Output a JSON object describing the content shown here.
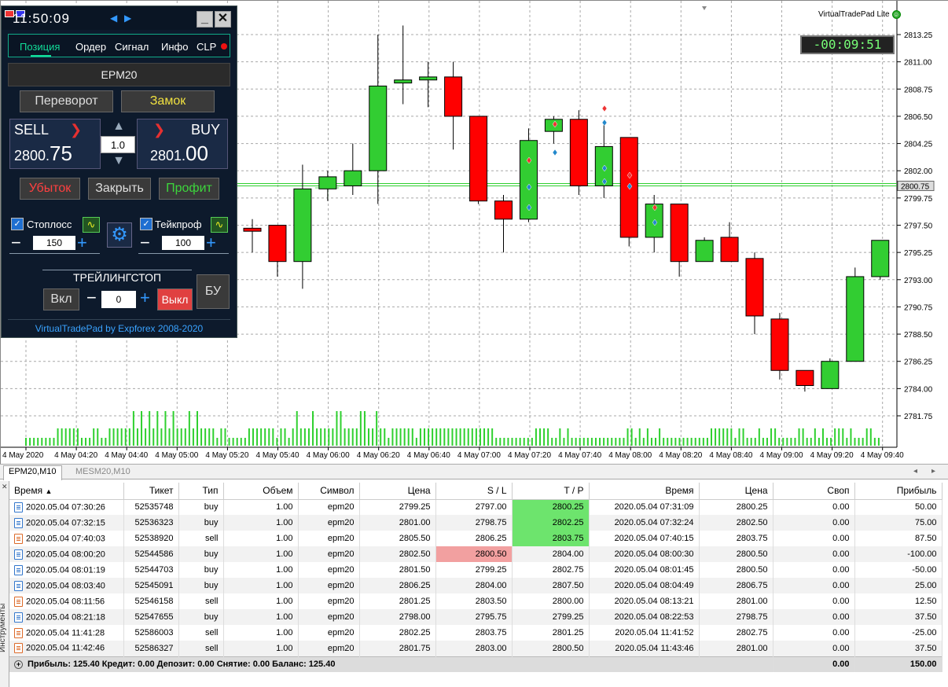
{
  "ea": {
    "title": "VirtualTradePad",
    "edition": "Lite"
  },
  "timer": "-00:09:51",
  "pad": {
    "clock": "11:50:09",
    "tabs": [
      "Позиция",
      "Ордер",
      "Сигнал",
      "Инфо",
      "CLP"
    ],
    "symbol": "EPM20",
    "reverse_label": "Переворот",
    "lock_label": "Замок",
    "sell_label": "SELL",
    "buy_label": "BUY",
    "sell_int": "2800.",
    "sell_frac": "75",
    "buy_int": "2801.",
    "buy_frac": "00",
    "lot": "1.0",
    "loss_label": "Убыток",
    "close_label": "Закрыть",
    "profit_label": "Профит",
    "sl_label": "Стоплосс",
    "sl_value": "150",
    "tp_label": "Тейкпроф",
    "tp_value": "100",
    "trailing_label": "ТРЕЙЛИНГСТОП",
    "on_label": "Вкл",
    "off_label": "Выкл",
    "trail_value": "0",
    "be_label": "БУ",
    "footer": "VirtualTradePad by Expforex 2008-2020",
    "colors": {
      "sell_arrow": "#e63030",
      "profit_text": "#3cd63c",
      "loss_text": "#ff4040",
      "lock_text": "#f0e040"
    }
  },
  "chart_data": {
    "type": "candlestick",
    "x_ticks": [
      "4 May 2020",
      "4 May 04:20",
      "4 May 04:40",
      "4 May 05:00",
      "4 May 05:20",
      "4 May 05:40",
      "4 May 06:00",
      "4 May 06:20",
      "4 May 06:40",
      "4 May 07:00",
      "4 May 07:20",
      "4 May 07:40",
      "4 May 08:00",
      "4 May 08:20",
      "4 May 08:40",
      "4 May 09:00",
      "4 May 09:20",
      "4 May 09:40"
    ],
    "y_ticks": [
      "2813.25",
      "2811.00",
      "2808.75",
      "2806.50",
      "2804.25",
      "2802.00",
      "2799.75",
      "2797.50",
      "2795.25",
      "2793.00",
      "2790.75",
      "2788.50",
      "2786.25",
      "2784.00",
      "2781.75"
    ],
    "ylim": [
      2780.0,
      2815.25
    ],
    "current_price": "2800.75",
    "current_price_value": 2800.75,
    "candles": [
      {
        "o": 2797.25,
        "h": 2798.0,
        "l": 2795.25,
        "c": 2797.0
      },
      {
        "o": 2797.5,
        "h": 2797.5,
        "l": 2793.25,
        "c": 2794.5
      },
      {
        "o": 2794.5,
        "h": 2802.5,
        "l": 2792.25,
        "c": 2800.5
      },
      {
        "o": 2800.5,
        "h": 2802.0,
        "l": 2799.5,
        "c": 2801.5
      },
      {
        "o": 2800.75,
        "h": 2804.25,
        "l": 2800.0,
        "c": 2802.0
      },
      {
        "o": 2802.0,
        "h": 2813.25,
        "l": 2799.25,
        "c": 2809.0
      },
      {
        "o": 2809.25,
        "h": 2814.0,
        "l": 2807.5,
        "c": 2809.5
      },
      {
        "o": 2809.5,
        "h": 2811.0,
        "l": 2807.25,
        "c": 2809.75
      },
      {
        "o": 2809.75,
        "h": 2811.0,
        "l": 2803.75,
        "c": 2806.5
      },
      {
        "o": 2806.5,
        "h": 2806.5,
        "l": 2799.25,
        "c": 2799.5
      },
      {
        "o": 2799.5,
        "h": 2800.0,
        "l": 2795.25,
        "c": 2798.0
      },
      {
        "o": 2798.0,
        "h": 2805.5,
        "l": 2797.75,
        "c": 2804.5
      },
      {
        "o": 2805.25,
        "h": 2806.5,
        "l": 2804.25,
        "c": 2806.25
      },
      {
        "o": 2806.25,
        "h": 2807.0,
        "l": 2800.0,
        "c": 2800.75
      },
      {
        "o": 2800.75,
        "h": 2806.0,
        "l": 2799.75,
        "c": 2804.0
      },
      {
        "o": 2804.75,
        "h": 2804.75,
        "l": 2795.75,
        "c": 2796.5
      },
      {
        "o": 2796.5,
        "h": 2800.0,
        "l": 2795.25,
        "c": 2799.25
      },
      {
        "o": 2799.25,
        "h": 2799.25,
        "l": 2793.25,
        "c": 2794.5
      },
      {
        "o": 2794.5,
        "h": 2796.5,
        "l": 2794.5,
        "c": 2796.25
      },
      {
        "o": 2796.5,
        "h": 2797.75,
        "l": 2794.5,
        "c": 2794.5
      },
      {
        "o": 2794.75,
        "h": 2795.25,
        "l": 2788.5,
        "c": 2790.0
      },
      {
        "o": 2789.75,
        "h": 2790.25,
        "l": 2784.75,
        "c": 2785.5
      },
      {
        "o": 2785.5,
        "h": 2785.5,
        "l": 2783.75,
        "c": 2784.25
      },
      {
        "o": 2784.0,
        "h": 2786.5,
        "l": 2784.0,
        "c": 2786.25
      },
      {
        "o": 2786.25,
        "h": 2794.0,
        "l": 2786.25,
        "c": 2793.25
      },
      {
        "o": 2793.25,
        "h": 2796.25,
        "l": 2793.0,
        "c": 2796.25
      }
    ],
    "volumes": [
      1,
      1,
      1,
      1,
      1,
      1,
      1,
      1,
      2,
      2,
      2,
      2,
      2,
      2,
      1,
      1,
      1,
      2,
      2,
      1,
      1,
      2,
      2,
      2,
      2,
      2,
      2,
      3,
      2,
      3,
      2,
      3,
      2,
      3,
      2,
      3,
      2,
      3,
      2,
      2,
      2,
      3,
      2,
      3,
      2,
      2,
      2,
      2,
      1,
      2,
      2,
      1,
      1,
      1,
      1,
      1,
      2,
      2,
      2,
      2,
      2,
      2,
      2,
      1,
      2,
      2,
      1,
      2,
      3,
      2,
      2,
      2,
      3,
      2,
      2,
      2,
      2,
      2,
      3,
      3,
      2,
      2,
      2,
      2,
      3,
      3,
      2,
      2,
      3,
      2,
      2,
      1,
      2,
      2,
      2,
      2,
      2,
      2,
      1,
      2,
      2,
      2,
      2,
      2,
      2,
      2,
      2,
      2,
      2,
      2,
      2,
      2,
      2,
      2,
      2,
      2,
      2,
      2,
      1,
      1,
      1,
      1,
      1,
      1,
      1,
      1,
      1,
      1,
      2,
      2,
      2,
      2,
      1,
      1,
      2,
      1,
      2,
      1,
      1,
      1,
      1,
      1,
      1,
      1,
      1,
      1,
      1,
      1,
      1,
      1,
      1,
      2,
      2,
      1,
      2,
      1,
      2,
      1,
      1,
      2,
      1,
      1,
      1,
      1,
      1,
      1,
      1,
      1,
      1,
      1,
      1,
      1,
      2,
      2,
      2,
      2,
      2,
      2,
      1,
      2,
      2,
      1,
      1,
      1,
      2,
      1,
      1,
      2,
      2,
      1,
      1,
      1,
      1,
      1,
      2,
      2,
      1,
      1,
      2,
      1,
      2,
      1,
      1,
      2,
      2,
      2,
      1,
      2,
      1,
      1,
      1,
      2,
      2,
      1,
      1
    ]
  },
  "tabsbar": {
    "tabs": [
      "EPM20,M10",
      "MESM20,M10"
    ],
    "nav_left": "◂",
    "nav_right": "▸"
  },
  "terminal": {
    "side_label": "Инструменты",
    "columns": [
      "Время",
      "Тикет",
      "Тип",
      "Объем",
      "Символ",
      "Цена",
      "S / L",
      "T / P",
      "Время",
      "Цена",
      "Своп",
      "Прибыль"
    ],
    "rows": [
      {
        "open": "2020.05.04 07:30:26",
        "ticket": "52535748",
        "type": "buy",
        "vol": "1.00",
        "sym": "epm20",
        "price": "2799.25",
        "sl": "2797.00",
        "tp": "2800.25",
        "close": "2020.05.04 07:31:09",
        "cprice": "2800.25",
        "swap": "0.00",
        "profit": "50.00",
        "hl": "tp"
      },
      {
        "open": "2020.05.04 07:32:15",
        "ticket": "52536323",
        "type": "buy",
        "vol": "1.00",
        "sym": "epm20",
        "price": "2801.00",
        "sl": "2798.75",
        "tp": "2802.25",
        "close": "2020.05.04 07:32:24",
        "cprice": "2802.50",
        "swap": "0.00",
        "profit": "75.00",
        "hl": "tp"
      },
      {
        "open": "2020.05.04 07:40:03",
        "ticket": "52538920",
        "type": "sell",
        "vol": "1.00",
        "sym": "epm20",
        "price": "2805.50",
        "sl": "2806.25",
        "tp": "2803.75",
        "close": "2020.05.04 07:40:15",
        "cprice": "2803.75",
        "swap": "0.00",
        "profit": "87.50",
        "hl": "tp"
      },
      {
        "open": "2020.05.04 08:00:20",
        "ticket": "52544586",
        "type": "buy",
        "vol": "1.00",
        "sym": "epm20",
        "price": "2802.50",
        "sl": "2800.50",
        "tp": "2804.00",
        "close": "2020.05.04 08:00:30",
        "cprice": "2800.50",
        "swap": "0.00",
        "profit": "-100.00",
        "hl": "sl"
      },
      {
        "open": "2020.05.04 08:01:19",
        "ticket": "52544703",
        "type": "buy",
        "vol": "1.00",
        "sym": "epm20",
        "price": "2801.50",
        "sl": "2799.25",
        "tp": "2802.75",
        "close": "2020.05.04 08:01:45",
        "cprice": "2800.50",
        "swap": "0.00",
        "profit": "-50.00",
        "hl": ""
      },
      {
        "open": "2020.05.04 08:03:40",
        "ticket": "52545091",
        "type": "buy",
        "vol": "1.00",
        "sym": "epm20",
        "price": "2806.25",
        "sl": "2804.00",
        "tp": "2807.50",
        "close": "2020.05.04 08:04:49",
        "cprice": "2806.75",
        "swap": "0.00",
        "profit": "25.00",
        "hl": ""
      },
      {
        "open": "2020.05.04 08:11:56",
        "ticket": "52546158",
        "type": "sell",
        "vol": "1.00",
        "sym": "epm20",
        "price": "2801.25",
        "sl": "2803.50",
        "tp": "2800.00",
        "close": "2020.05.04 08:13:21",
        "cprice": "2801.00",
        "swap": "0.00",
        "profit": "12.50",
        "hl": ""
      },
      {
        "open": "2020.05.04 08:21:18",
        "ticket": "52547655",
        "type": "buy",
        "vol": "1.00",
        "sym": "epm20",
        "price": "2798.00",
        "sl": "2795.75",
        "tp": "2799.25",
        "close": "2020.05.04 08:22:53",
        "cprice": "2798.75",
        "swap": "0.00",
        "profit": "37.50",
        "hl": ""
      },
      {
        "open": "2020.05.04 11:41:28",
        "ticket": "52586003",
        "type": "sell",
        "vol": "1.00",
        "sym": "epm20",
        "price": "2802.25",
        "sl": "2803.75",
        "tp": "2801.25",
        "close": "2020.05.04 11:41:52",
        "cprice": "2802.75",
        "swap": "0.00",
        "profit": "-25.00",
        "hl": ""
      },
      {
        "open": "2020.05.04 11:42:46",
        "ticket": "52586327",
        "type": "sell",
        "vol": "1.00",
        "sym": "epm20",
        "price": "2801.75",
        "sl": "2803.00",
        "tp": "2800.50",
        "close": "2020.05.04 11:43:46",
        "cprice": "2801.00",
        "swap": "0.00",
        "profit": "37.50",
        "hl": ""
      }
    ],
    "summary": "Прибыль: 125.40  Кредит: 0.00  Депозит: 0.00  Снятие: 0.00  Баланс: 125.40",
    "total_swap": "0.00",
    "total_profit": "150.00"
  }
}
